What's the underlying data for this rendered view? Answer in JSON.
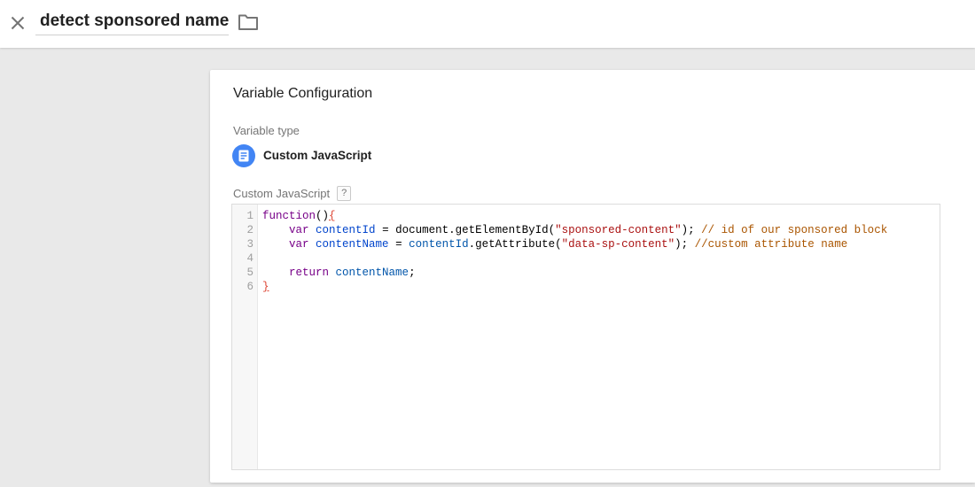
{
  "header": {
    "title_value": "detect sponsored name"
  },
  "panel": {
    "title": "Variable Configuration",
    "variable_type_label": "Variable type",
    "variable_type": {
      "name": "Custom JavaScript"
    },
    "code_field_label": "Custom JavaScript",
    "help_badge": "?"
  },
  "code_editor": {
    "lines": [
      {
        "n": "1",
        "tokens": [
          [
            "function",
            "kw"
          ],
          [
            "()",
            "pl"
          ],
          [
            "{",
            "br"
          ]
        ]
      },
      {
        "n": "2",
        "tokens": [
          [
            "    ",
            "pl"
          ],
          [
            "var",
            "kw"
          ],
          [
            " ",
            "pl"
          ],
          [
            "contentId",
            "def"
          ],
          [
            " = ",
            "pl"
          ],
          [
            "document.getElementById(",
            "pl"
          ],
          [
            "\"sponsored-content\"",
            "str"
          ],
          [
            "); ",
            "pl"
          ],
          [
            "// id of our sponsored block",
            "com"
          ]
        ]
      },
      {
        "n": "3",
        "tokens": [
          [
            "    ",
            "pl"
          ],
          [
            "var",
            "kw"
          ],
          [
            " ",
            "pl"
          ],
          [
            "contentName",
            "def"
          ],
          [
            " = ",
            "pl"
          ],
          [
            "contentId",
            "var"
          ],
          [
            ".getAttribute(",
            "pl"
          ],
          [
            "\"data-sp-content\"",
            "str"
          ],
          [
            "); ",
            "pl"
          ],
          [
            "//custom attribute name",
            "com"
          ]
        ]
      },
      {
        "n": "4",
        "tokens": []
      },
      {
        "n": "5",
        "tokens": [
          [
            "    ",
            "pl"
          ],
          [
            "return",
            "kw"
          ],
          [
            " ",
            "pl"
          ],
          [
            "contentName",
            "var"
          ],
          [
            ";",
            "pl"
          ]
        ]
      },
      {
        "n": "6",
        "tokens": [
          [
            "}",
            "br"
          ]
        ]
      }
    ]
  },
  "colors": {
    "accent_blue": "#4285f4",
    "icon_gray": "#757575",
    "keyword": "#770088",
    "definition": "#0044cc",
    "variable": "#0055aa",
    "string": "#aa1111",
    "comment": "#aa5500",
    "bracket": "#dd4433",
    "plain": "#000000"
  }
}
